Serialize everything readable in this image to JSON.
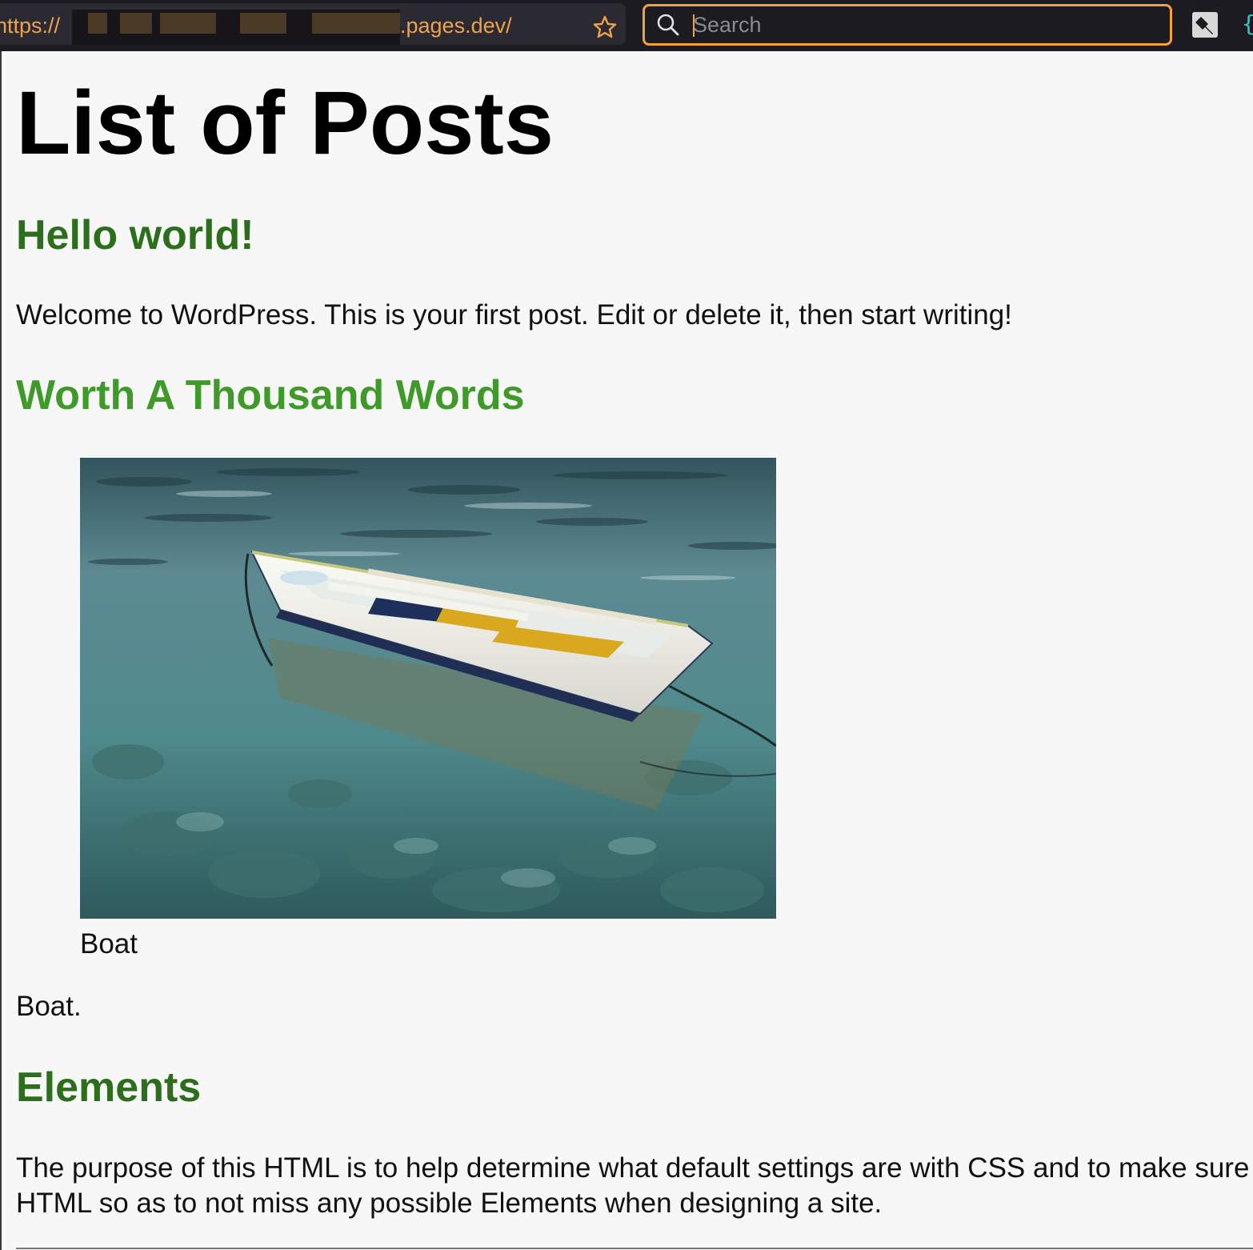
{
  "browser": {
    "url_scheme": "https://",
    "url_domain": ".pages.dev/",
    "search_placeholder": "Search",
    "extension_glyph": "{"
  },
  "icons": {
    "bookmark": "star-icon",
    "search": "magnifier-icon",
    "extension_pin": "pin-icon",
    "extension_brace": "brace-icon"
  },
  "colors": {
    "url_text": "#f0a24a",
    "search_border": "#f5a13a",
    "post_title": "#2c6e1c",
    "post_title_hover": "#3f9a2a"
  },
  "page": {
    "title": "List of Posts",
    "posts": [
      {
        "title": "Hello world!",
        "body": "Welcome to WordPress. This is your first post. Edit or delete it, then start writing!"
      },
      {
        "title": "Worth A Thousand Words",
        "image_caption": "Boat",
        "body": "Boat."
      },
      {
        "title": "Elements",
        "body": "The purpose of this HTML is to help determine what default settings are with CSS and to make sure HTML so as to not miss any possible Elements when designing a site."
      }
    ]
  }
}
